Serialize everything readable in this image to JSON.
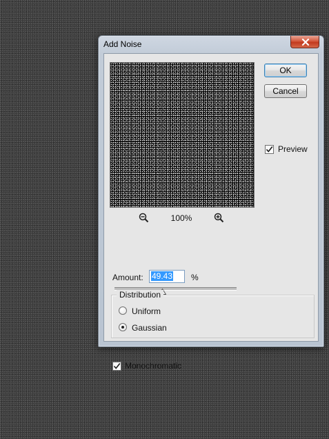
{
  "dialog": {
    "title": "Add Noise",
    "close_icon": "close-icon"
  },
  "preview": {
    "zoom_level": "100%",
    "zoom_out_icon": "zoom-out-icon",
    "zoom_in_icon": "zoom-in-icon"
  },
  "buttons": {
    "ok_label": "OK",
    "cancel_label": "Cancel"
  },
  "preview_toggle": {
    "label": "Preview",
    "checked": true
  },
  "amount": {
    "label": "Amount:",
    "value": "49.43",
    "unit": "%",
    "slider_fraction": 0.4943
  },
  "distribution": {
    "title": "Distribution",
    "options": [
      {
        "label": "Uniform",
        "selected": false
      },
      {
        "label": "Gaussian",
        "selected": true
      }
    ]
  },
  "monochromatic": {
    "label": "Monochromatic",
    "checked": true
  }
}
